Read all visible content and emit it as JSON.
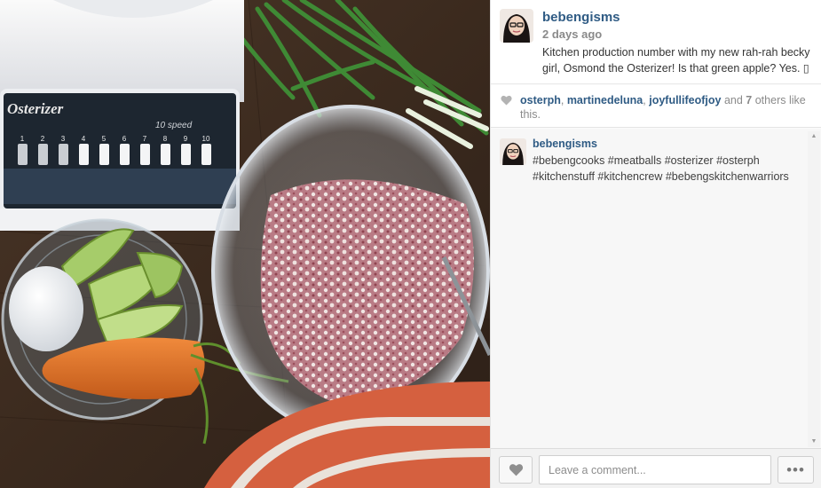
{
  "post": {
    "username": "bebengisms",
    "time_ago": "2 days ago",
    "caption": "Kitchen production number with my new rah-rah becky girl, Osmond the Osterizer! Is that green apple? Yes. ▯"
  },
  "photo": {
    "blender_brand": "Osterizer",
    "blender_speed": "10 speed",
    "button_numbers": [
      "1",
      "2",
      "3",
      "4",
      "5",
      "6",
      "7",
      "8",
      "9",
      "10"
    ]
  },
  "likes": {
    "likers": [
      "osterph",
      "martinedeluna",
      "joyfullifeofjoy"
    ],
    "separator": ",",
    "and_text": "and",
    "others_count": "7",
    "others_text": "others like this."
  },
  "comments": [
    {
      "username": "bebengisms",
      "text": "#bebengcooks #meatballs #osterizer #osterph #kitchenstuff #kitchencrew #bebengskitchenwarriors"
    }
  ],
  "scrollbar": {
    "up_arrow": "▲",
    "down_arrow": "▼"
  },
  "footer": {
    "comment_placeholder": "Leave a comment...",
    "more_label": "•••"
  },
  "colors": {
    "username_blue": "#2f5b84",
    "muted_gray": "#8a8a8a",
    "panel_bg": "#f7f7f7"
  },
  "icons": [
    "heart-icon",
    "more-options-icon",
    "scroll-up-icon",
    "scroll-down-icon"
  ]
}
